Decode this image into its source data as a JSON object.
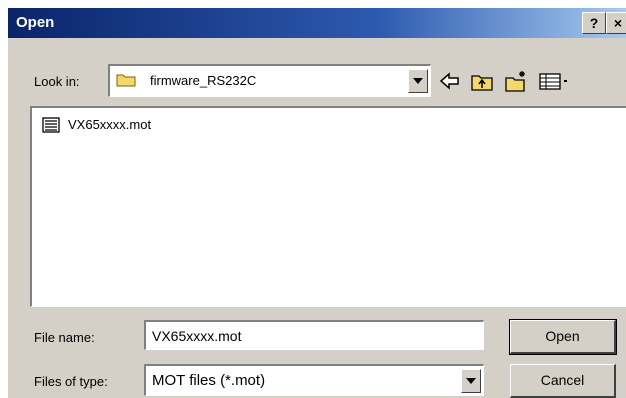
{
  "window": {
    "title": "Open",
    "help_label": "?",
    "close_label": "×"
  },
  "look_in": {
    "label": "Look in:",
    "value": "firmware_RS232C"
  },
  "toolbar": {
    "icons": [
      "back-icon",
      "up-folder-icon",
      "new-folder-icon",
      "view-menu-icon"
    ]
  },
  "files": [
    {
      "name": "VX65xxxx.mot",
      "icon": "mot-file-icon"
    }
  ],
  "file_name": {
    "label": "File name:",
    "value": "VX65xxxx.mot"
  },
  "file_type": {
    "label": "Files of type:",
    "value": "MOT files (*.mot)"
  },
  "buttons": {
    "open": "Open",
    "cancel": "Cancel"
  },
  "colors": {
    "title_start": "#0a246a",
    "title_end": "#a6caf0",
    "face": "#d4d0c8"
  }
}
